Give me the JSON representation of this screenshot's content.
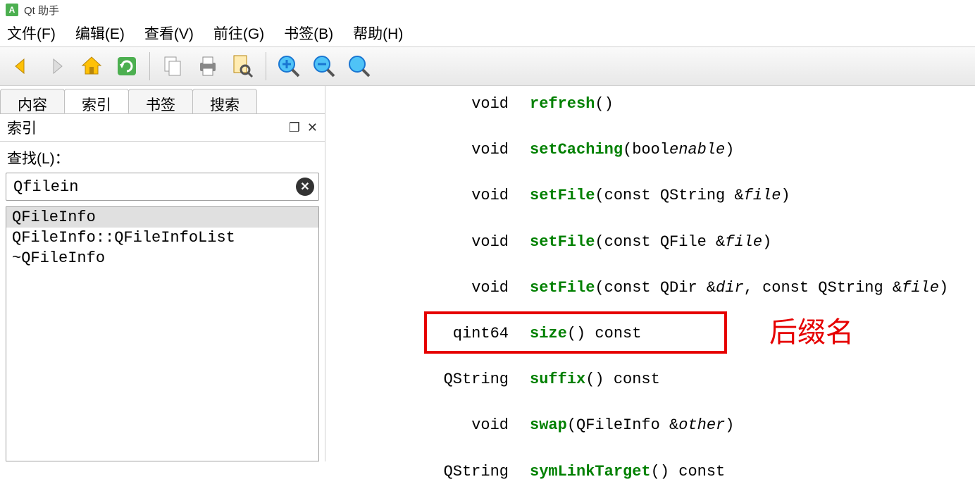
{
  "title": "Qt 助手",
  "menus": [
    "文件(F)",
    "编辑(E)",
    "查看(V)",
    "前往(G)",
    "书签(B)",
    "帮助(H)"
  ],
  "tabs": {
    "items": [
      "内容",
      "索引",
      "书签",
      "搜索"
    ],
    "active_index": 1
  },
  "panel": {
    "title": "索引",
    "lookfor_label": "查找(L)：",
    "search_value": "Qfilein"
  },
  "results": {
    "items": [
      "QFileInfo",
      "QFileInfo::QFileInfoList",
      "~QFileInfo"
    ],
    "selected_index": 0
  },
  "functions": [
    {
      "return": "void",
      "name": "refresh",
      "params": []
    },
    {
      "return": "void",
      "name": "setCaching",
      "params": [
        {
          "type": "bool",
          "name": "enable"
        }
      ]
    },
    {
      "return": "void",
      "name": "setFile",
      "params": [
        {
          "type": "const QString &",
          "name": "file"
        }
      ]
    },
    {
      "return": "void",
      "name": "setFile",
      "params": [
        {
          "type": "const QFile &",
          "name": "file"
        }
      ]
    },
    {
      "return": "void",
      "name": "setFile",
      "params": [
        {
          "type": "const QDir &",
          "name": "dir"
        },
        {
          "type": "const QString &",
          "name": "file"
        }
      ]
    },
    {
      "return": "qint64",
      "name": "size",
      "params": [],
      "const": true
    },
    {
      "return": "QString",
      "name": "suffix",
      "params": [],
      "const": true,
      "highlighted": true
    },
    {
      "return": "void",
      "name": "swap",
      "params": [
        {
          "type": "QFileInfo &",
          "name": "other"
        }
      ]
    },
    {
      "return": "QString",
      "name": "symLinkTarget",
      "params": [],
      "const": true
    }
  ],
  "annotation": "后缀名"
}
